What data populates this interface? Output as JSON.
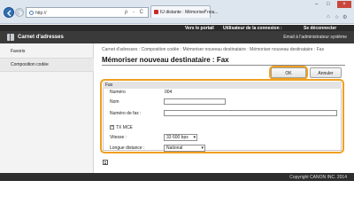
{
  "browser": {
    "address_text": "http://",
    "address_tools": "ρ - C",
    "tab_title": "IU distante : Mémoriser nou...",
    "tab_close": "×",
    "win_min": "–",
    "win_max": "□",
    "win_close": "×",
    "home_icon": "⌂",
    "star_icon": "☆",
    "gear_icon": "⚙"
  },
  "topbar": {
    "portal": "Vers le portail",
    "user": "Utilisateur de la connexion :",
    "logout": "Se déconnecter"
  },
  "header": {
    "title": "Carnet d'adresses",
    "admin_mail": "Email à l'administrateur système"
  },
  "sidebar": {
    "items": [
      {
        "label": "Favoris"
      },
      {
        "label": "Composition codée"
      }
    ]
  },
  "main": {
    "breadcrumb": "Carnet d'adresses : Composition codée : Mémoriser nouveau destinataire : Mémoriser nouveau destinataire : Fax",
    "title": "Mémoriser nouveau destinataire : Fax",
    "ok_label": "OK",
    "cancel_label": "Annuler"
  },
  "fax": {
    "legend": "Fax",
    "numero_label": "Numéro",
    "numero_value": "004",
    "nom_label": "Nom",
    "nom_value": "",
    "fax_label": "Numéro de fax :",
    "fax_value": "",
    "txm_label": "TX MCE",
    "txm_checked": true,
    "vitesse_label": "Vitesse :",
    "vitesse_value": "33 600 bps",
    "longue_label": "Longue distance :",
    "longue_value": "National"
  },
  "footer": {
    "copyright": "Copyright CANON INC. 2014"
  },
  "colors": {
    "highlight": "#f0a020",
    "header_bg": "#3a3a3a",
    "topbar_bg": "#2a2a2a",
    "back_button": "#2f6fb5"
  }
}
